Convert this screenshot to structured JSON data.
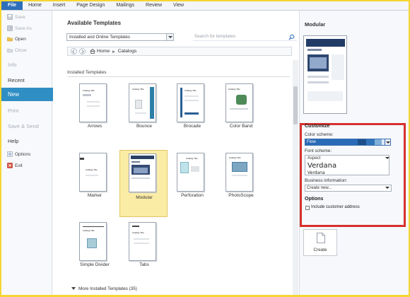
{
  "ribbon": {
    "tabs": [
      "File",
      "Home",
      "Insert",
      "Page Design",
      "Mailings",
      "Review",
      "View"
    ]
  },
  "nav": {
    "save": "Save",
    "save_as": "Save As",
    "open": "Open",
    "close": "Close",
    "info": "Info",
    "recent": "Recent",
    "new": "New",
    "print": "Print",
    "save_send": "Save & Send",
    "help": "Help",
    "options": "Options",
    "exit": "Exit"
  },
  "main": {
    "title": "Available Templates",
    "dropdown_value": "Installed and Online Templates",
    "search_placeholder": "Search for templates",
    "breadcrumb": {
      "home": "Home",
      "current": "Catalogs"
    },
    "section_title": "Installed Templates",
    "templates": [
      "Arrows",
      "Bounce",
      "Brocade",
      "Color Band",
      "Marker",
      "Modular",
      "Perforation",
      "PhotoScope",
      "Simple Divider",
      "Tabs"
    ],
    "selected_template": "Modular",
    "more_label": "More Installed Templates (35)"
  },
  "thumb_text": {
    "catalog": "Catalog Title"
  },
  "preview": {
    "title": "Modular"
  },
  "customize": {
    "title": "Customize",
    "color_scheme_label": "Color scheme:",
    "color_scheme_value": "Flow",
    "font_scheme_label": "Font scheme:",
    "font_scheme_name": "Aspect",
    "font_scheme_major": "Verdana",
    "font_scheme_minor": "Verdana",
    "business_info_label": "Business information:",
    "business_info_value": "Create new..."
  },
  "options": {
    "title": "Options",
    "include_customer_address": "Include customer address",
    "include_customer_address_checked": false
  },
  "create_label": "Create",
  "colors": {
    "accent": "#2f8ec4",
    "file_tab": "#2f6fba",
    "selection": "#fbeca5",
    "highlight_box": "#d6302d",
    "frame": "#f5d632"
  }
}
